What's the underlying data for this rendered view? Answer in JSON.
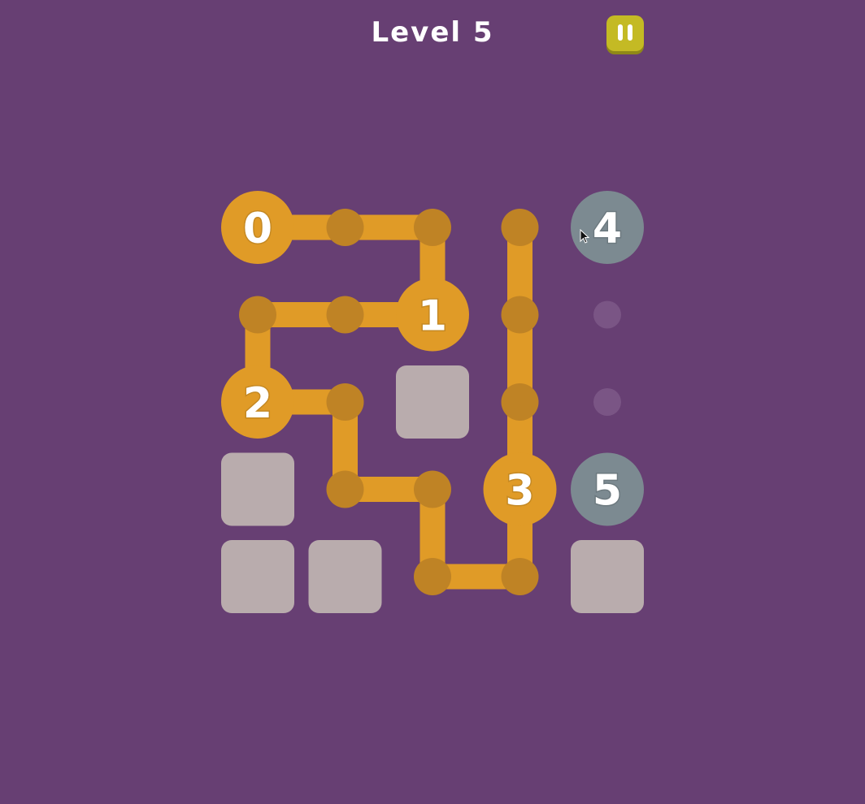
{
  "header": {
    "title": "Level 5",
    "pause_label": "pause"
  },
  "colors": {
    "background": "#673f73",
    "path": "#e09b27",
    "path_dot": "#bf8325",
    "empty_dot": "#7a5585",
    "node_gray": "#7c8a91",
    "blocked": "#b9acad",
    "pause": "#c4ba24"
  },
  "grid": {
    "cols": 5,
    "rows": 5
  },
  "blocked_cells": [
    [
      2,
      2
    ],
    [
      0,
      3
    ],
    [
      0,
      4
    ],
    [
      1,
      4
    ],
    [
      4,
      4
    ]
  ],
  "empty_dots": [
    [
      4,
      1
    ],
    [
      4,
      2
    ]
  ],
  "path": [
    [
      0,
      0
    ],
    [
      1,
      0
    ],
    [
      2,
      0
    ],
    [
      2,
      1
    ],
    [
      1,
      1
    ],
    [
      0,
      1
    ],
    [
      0,
      2
    ],
    [
      1,
      2
    ],
    [
      1,
      3
    ],
    [
      2,
      3
    ],
    [
      2,
      4
    ],
    [
      3,
      4
    ],
    [
      3,
      3
    ],
    [
      3,
      2
    ],
    [
      3,
      1
    ],
    [
      3,
      0
    ]
  ],
  "numbered_nodes": [
    {
      "label": "0",
      "cell": [
        0,
        0
      ],
      "state": "visited"
    },
    {
      "label": "1",
      "cell": [
        2,
        1
      ],
      "state": "visited"
    },
    {
      "label": "2",
      "cell": [
        0,
        2
      ],
      "state": "visited"
    },
    {
      "label": "3",
      "cell": [
        3,
        3
      ],
      "state": "visited"
    },
    {
      "label": "4",
      "cell": [
        4,
        0
      ],
      "state": "pending"
    },
    {
      "label": "5",
      "cell": [
        4,
        3
      ],
      "state": "pending"
    }
  ],
  "icons": {
    "pause": "pause-icon",
    "cursor": "mouse-pointer-icon"
  }
}
